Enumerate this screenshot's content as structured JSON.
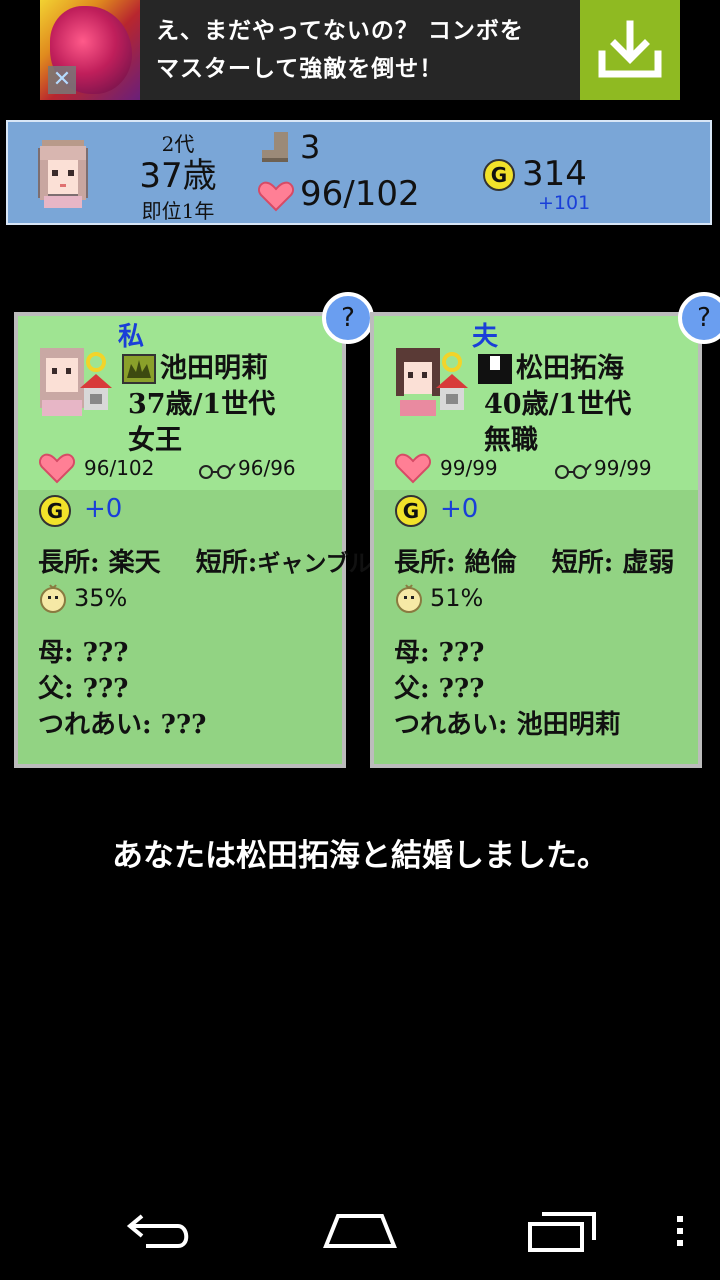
{
  "ad": {
    "text_line1": "え、まだやってないの？ コンボを",
    "text_line2": "マスターして強敵を倒せ！",
    "close_glyph": "✕",
    "download_color": "#8fba22"
  },
  "status": {
    "generation": "2代",
    "age": "37歳",
    "reign": "即位1年",
    "steps": "3",
    "hp": "96/102",
    "gold": "314",
    "gold_income": "+101"
  },
  "cards": [
    {
      "role": "私",
      "help": "?",
      "name": "池田明莉",
      "age_generation": "37歳/1世代",
      "occupation": "女王",
      "hp": "96/102",
      "intelligence": "96/96",
      "money": "+0",
      "strength_label": "長所:",
      "strength": "楽天",
      "weakness_label": "短所:",
      "weakness": "ギャンブル",
      "fertility": "35%",
      "mother": "母: ???",
      "father": "父: ???",
      "partner": "つれあい: ???"
    },
    {
      "role": "夫",
      "help": "?",
      "name": "松田拓海",
      "age_generation": "40歳/1世代",
      "occupation": "無職",
      "hp": "99/99",
      "intelligence": "99/99",
      "money": "+0",
      "strength_label": "長所:",
      "strength": "絶倫",
      "weakness_label": "短所:",
      "weakness": "虚弱",
      "fertility": "51%",
      "mother": "母: ???",
      "father": "父: ???",
      "partner": "つれあい: 池田明莉"
    }
  ],
  "message": "あなたは松田拓海と結婚しました。",
  "colors": {
    "status_bg": "#7aa6d7",
    "card_bg": "#9fe492",
    "accent_blue": "#1a3fd8",
    "heart": "#ff7f95",
    "coin": "#f2e22a"
  },
  "icons": {
    "nav": [
      "back-icon",
      "home-icon",
      "recent-apps-icon",
      "menu-icon"
    ]
  }
}
